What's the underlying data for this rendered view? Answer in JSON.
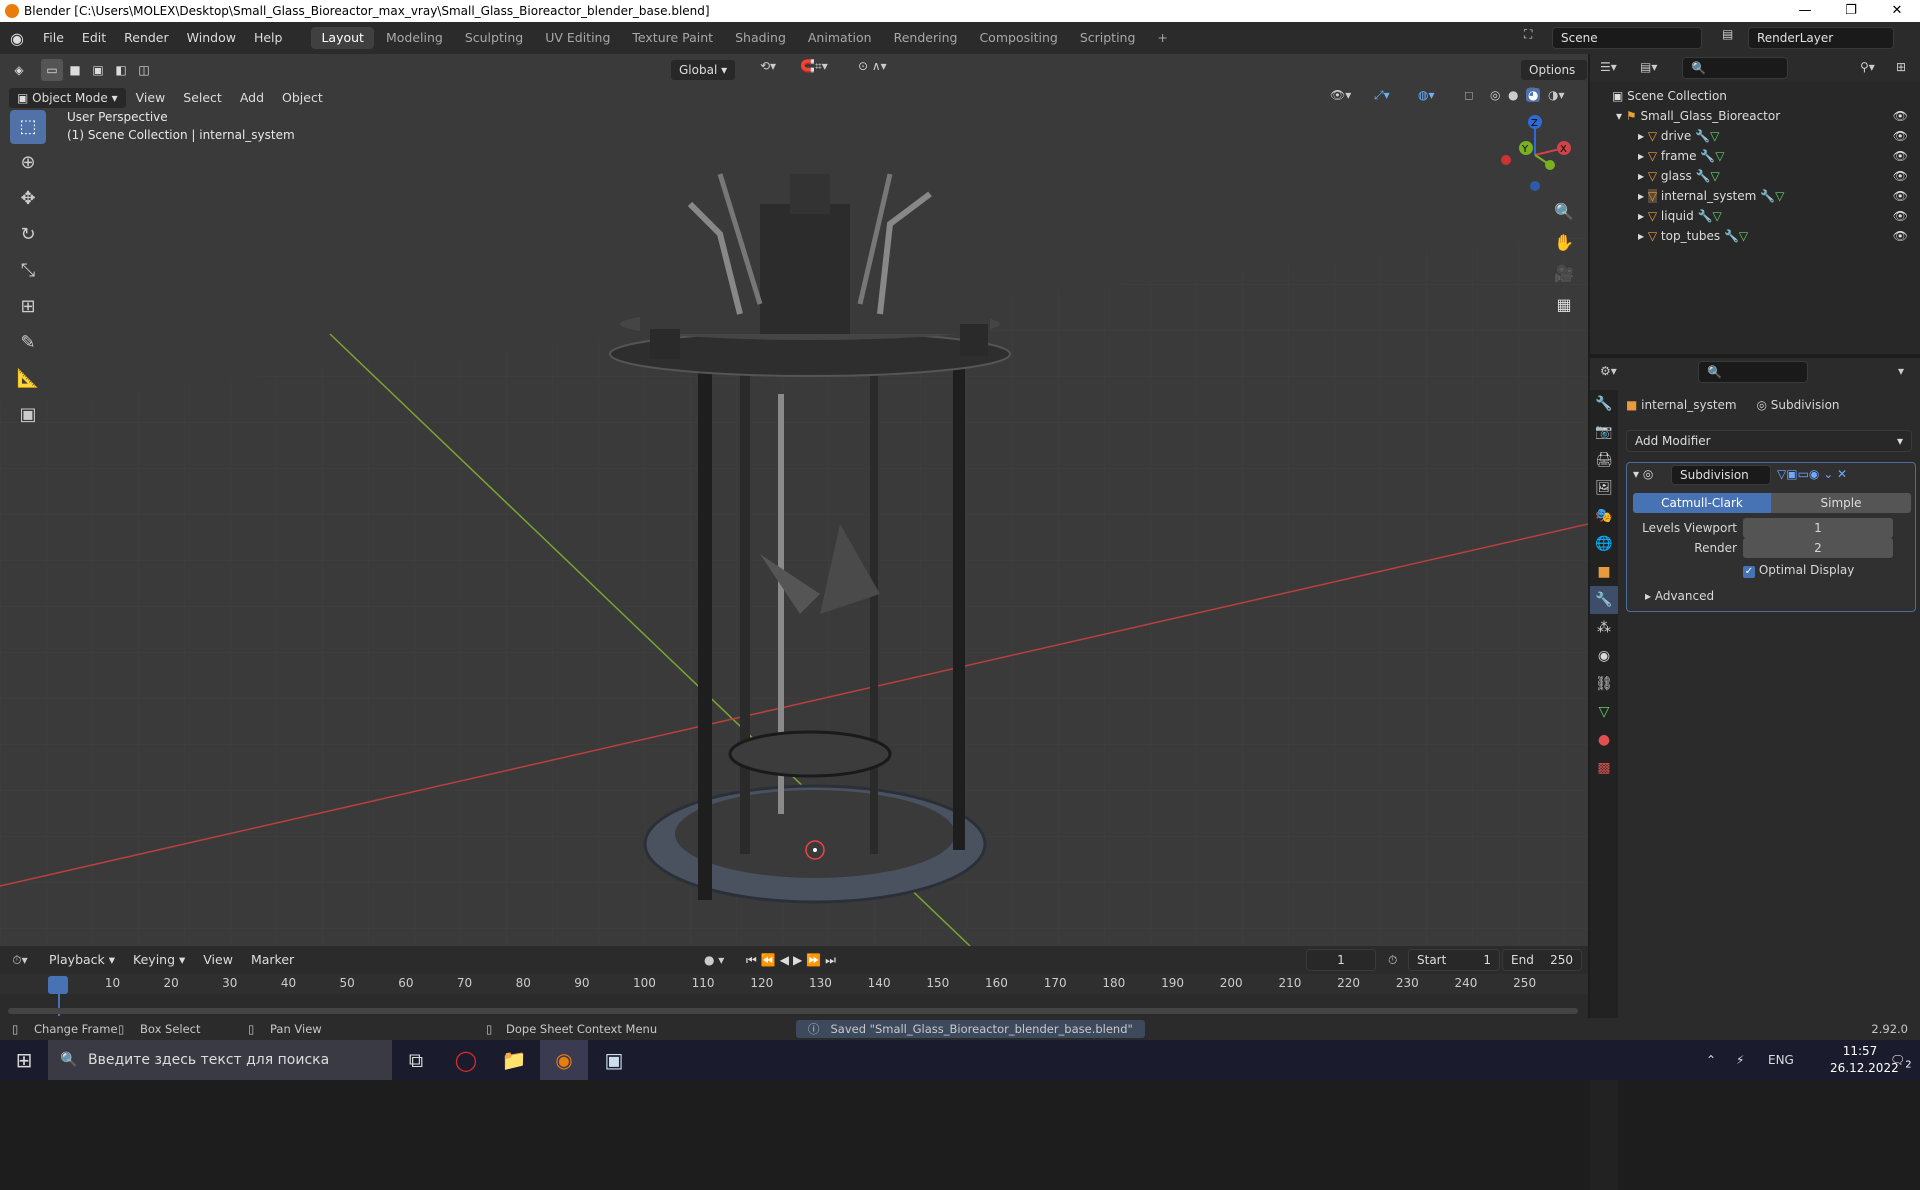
{
  "window": {
    "title": "Blender [C:\\Users\\MOLEX\\Desktop\\Small_Glass_Bioreactor_max_vray\\Small_Glass_Bioreactor_blender_base.blend]",
    "min": "—",
    "max": "❐",
    "close": "✕"
  },
  "menus": [
    "File",
    "Edit",
    "Render",
    "Window",
    "Help"
  ],
  "workspaces": [
    "Layout",
    "Modeling",
    "Sculpting",
    "UV Editing",
    "Texture Paint",
    "Shading",
    "Animation",
    "Rendering",
    "Compositing",
    "Scripting",
    "+"
  ],
  "scene": {
    "name": "Scene",
    "render_layer": "RenderLayer"
  },
  "viewport": {
    "mode": "Object Mode",
    "header_menus": [
      "View",
      "Select",
      "Add",
      "Object"
    ],
    "orientation": "Global",
    "options": "Options",
    "overlay_title": "User Perspective",
    "overlay_sub": "(1) Scene Collection | internal_system",
    "gizmo": {
      "x": "X",
      "y": "Y",
      "z": "Z"
    }
  },
  "outliner": {
    "root": "Scene Collection",
    "collection": "Small_Glass_Bioreactor",
    "items": [
      "drive",
      "frame",
      "glass",
      "internal_system",
      "liquid",
      "top_tubes"
    ]
  },
  "properties": {
    "object": "internal_system",
    "modifier_tab": "Subdivision",
    "add_modifier": "Add Modifier",
    "modifier_name": "Subdivision",
    "mode_catmull": "Catmull-Clark",
    "mode_simple": "Simple",
    "levels_label": "Levels Viewport",
    "levels_value": "1",
    "render_label": "Render",
    "render_value": "2",
    "optimal": "Optimal Display",
    "advanced": "Advanced"
  },
  "timeline": {
    "menus": [
      "Playback",
      "Keying",
      "View",
      "Marker"
    ],
    "current": "1",
    "start_label": "Start",
    "start": "1",
    "end_label": "End",
    "end": "250",
    "ticks": [
      "1",
      "10",
      "20",
      "30",
      "40",
      "50",
      "60",
      "70",
      "80",
      "90",
      "100",
      "110",
      "120",
      "130",
      "140",
      "150",
      "160",
      "170",
      "180",
      "190",
      "200",
      "210",
      "220",
      "230",
      "240",
      "250"
    ]
  },
  "status": {
    "change_frame": "Change Frame",
    "box_select": "Box Select",
    "pan_view": "Pan View",
    "context_menu": "Dope Sheet Context Menu",
    "saved": "Saved \"Small_Glass_Bioreactor_blender_base.blend\"",
    "version": "2.92.0"
  },
  "taskbar": {
    "search": "Введите здесь текст для поиска",
    "lang": "ENG",
    "time": "11:57",
    "date": "26.12.2022",
    "notif": "2"
  }
}
